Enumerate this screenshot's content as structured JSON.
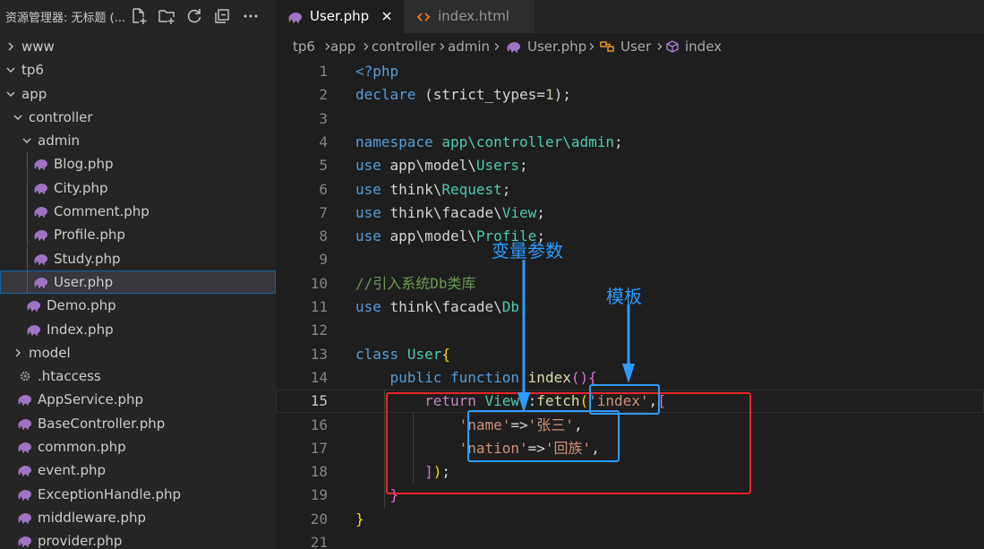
{
  "explorer": {
    "title": "资源管理器: 无标题 (...",
    "actions": [
      "new-file",
      "new-folder",
      "refresh",
      "collapse-all",
      "more"
    ]
  },
  "tree": [
    {
      "label": "www",
      "type": "folder",
      "expanded": false,
      "depth": 0
    },
    {
      "label": "tp6",
      "type": "folder",
      "expanded": true,
      "depth": 0
    },
    {
      "label": "app",
      "type": "folder",
      "expanded": true,
      "depth": 1
    },
    {
      "label": "controller",
      "type": "folder",
      "expanded": true,
      "depth": 2
    },
    {
      "label": "admin",
      "type": "folder",
      "expanded": true,
      "depth": 3
    },
    {
      "label": "Blog.php",
      "type": "php",
      "depth": 4
    },
    {
      "label": "City.php",
      "type": "php",
      "depth": 4
    },
    {
      "label": "Comment.php",
      "type": "php",
      "depth": 4
    },
    {
      "label": "Profile.php",
      "type": "php",
      "depth": 4
    },
    {
      "label": "Study.php",
      "type": "php",
      "depth": 4
    },
    {
      "label": "User.php",
      "type": "php",
      "depth": 4,
      "selected": true
    },
    {
      "label": "Demo.php",
      "type": "php",
      "depth": 3
    },
    {
      "label": "Index.php",
      "type": "php",
      "depth": 3
    },
    {
      "label": "model",
      "type": "folder",
      "expanded": false,
      "depth": 2
    },
    {
      "label": ".htaccess",
      "type": "config",
      "depth": 2
    },
    {
      "label": "AppService.php",
      "type": "php",
      "depth": 2
    },
    {
      "label": "BaseController.php",
      "type": "php",
      "depth": 2
    },
    {
      "label": "common.php",
      "type": "php",
      "depth": 2
    },
    {
      "label": "event.php",
      "type": "php",
      "depth": 2
    },
    {
      "label": "ExceptionHandle.php",
      "type": "php",
      "depth": 2
    },
    {
      "label": "middleware.php",
      "type": "php",
      "depth": 2
    },
    {
      "label": "provider.php",
      "type": "php",
      "depth": 2
    }
  ],
  "tabs": [
    {
      "label": "User.php",
      "icon": "php-elephant-icon",
      "active": true
    },
    {
      "label": "index.html",
      "icon": "html-icon",
      "active": false
    }
  ],
  "breadcrumb": [
    "tp6",
    "app",
    "controller",
    "admin",
    "User.php",
    "User",
    "index"
  ],
  "editor": {
    "current_line": 15,
    "lines": [
      {
        "n": "1",
        "tokens": [
          [
            "kw",
            "<?php"
          ]
        ]
      },
      {
        "n": "2",
        "tokens": [
          [
            "kw",
            "declare"
          ],
          [
            "pun",
            " (strict_types="
          ],
          [
            "num",
            "1"
          ],
          [
            "pun",
            ");"
          ]
        ]
      },
      {
        "n": "3",
        "tokens": []
      },
      {
        "n": "4",
        "tokens": [
          [
            "kw",
            "namespace"
          ],
          [
            "pun",
            " "
          ],
          [
            "cls",
            "app\\controller\\admin"
          ],
          [
            "pun",
            ";"
          ]
        ]
      },
      {
        "n": "5",
        "tokens": [
          [
            "kw",
            "use"
          ],
          [
            "pun",
            " app\\model\\"
          ],
          [
            "cls",
            "Users"
          ],
          [
            "pun",
            ";"
          ]
        ]
      },
      {
        "n": "6",
        "tokens": [
          [
            "kw",
            "use"
          ],
          [
            "pun",
            " think\\"
          ],
          [
            "cls",
            "Request"
          ],
          [
            "pun",
            ";"
          ]
        ]
      },
      {
        "n": "7",
        "tokens": [
          [
            "kw",
            "use"
          ],
          [
            "pun",
            " think\\facade\\"
          ],
          [
            "cls",
            "View"
          ],
          [
            "pun",
            ";"
          ]
        ]
      },
      {
        "n": "8",
        "tokens": [
          [
            "kw",
            "use"
          ],
          [
            "pun",
            " app\\model\\"
          ],
          [
            "cls",
            "Profile"
          ],
          [
            "pun",
            ";"
          ]
        ]
      },
      {
        "n": "9",
        "tokens": []
      },
      {
        "n": "10",
        "tokens": [
          [
            "cmt",
            "//引入系统Db类库"
          ]
        ]
      },
      {
        "n": "11",
        "tokens": [
          [
            "kw",
            "use"
          ],
          [
            "pun",
            " think\\facade\\"
          ],
          [
            "cls",
            "Db"
          ],
          [
            "pun",
            ";"
          ]
        ]
      },
      {
        "n": "12",
        "tokens": []
      },
      {
        "n": "13",
        "tokens": [
          [
            "kw",
            "class"
          ],
          [
            "pun",
            " "
          ],
          [
            "cls",
            "User"
          ],
          [
            "brk",
            "{"
          ]
        ]
      },
      {
        "n": "14",
        "tokens": [
          [
            "pun",
            "    "
          ],
          [
            "kw",
            "public"
          ],
          [
            "pun",
            " "
          ],
          [
            "kw",
            "function"
          ],
          [
            "pun",
            " "
          ],
          [
            "fn",
            "index"
          ],
          [
            "brk2",
            "()"
          ],
          [
            "brk2",
            "{"
          ]
        ]
      },
      {
        "n": "15",
        "tokens": [
          [
            "pun",
            "        "
          ],
          [
            "ctl",
            "return"
          ],
          [
            "pun",
            " "
          ],
          [
            "cls",
            "View"
          ],
          [
            "pun",
            "::"
          ],
          [
            "fn",
            "fetch"
          ],
          [
            "brk",
            "("
          ],
          [
            "str",
            "'index'"
          ],
          [
            "pun",
            ","
          ],
          [
            "brk2",
            "["
          ]
        ]
      },
      {
        "n": "16",
        "tokens": [
          [
            "pun",
            "            "
          ],
          [
            "str",
            "'name'"
          ],
          [
            "pun",
            "=>"
          ],
          [
            "str",
            "'张三'"
          ],
          [
            "pun",
            ","
          ]
        ]
      },
      {
        "n": "17",
        "tokens": [
          [
            "pun",
            "            "
          ],
          [
            "str",
            "'nation'"
          ],
          [
            "pun",
            "=>"
          ],
          [
            "str",
            "'回族'"
          ],
          [
            "pun",
            ","
          ]
        ]
      },
      {
        "n": "18",
        "tokens": [
          [
            "pun",
            "        "
          ],
          [
            "brk2",
            "]"
          ],
          [
            "brk",
            ")"
          ],
          [
            "pun",
            ";"
          ]
        ]
      },
      {
        "n": "19",
        "tokens": [
          [
            "pun",
            "    "
          ],
          [
            "brk2",
            "}"
          ]
        ]
      },
      {
        "n": "20",
        "tokens": [
          [
            "brk",
            "}"
          ]
        ]
      },
      {
        "n": "21",
        "tokens": []
      }
    ]
  },
  "annotations": {
    "variable_label": "变量参数",
    "template_label": "模板",
    "colors": {
      "red_box": "#e8262b",
      "blue": "#2e9bff"
    }
  }
}
